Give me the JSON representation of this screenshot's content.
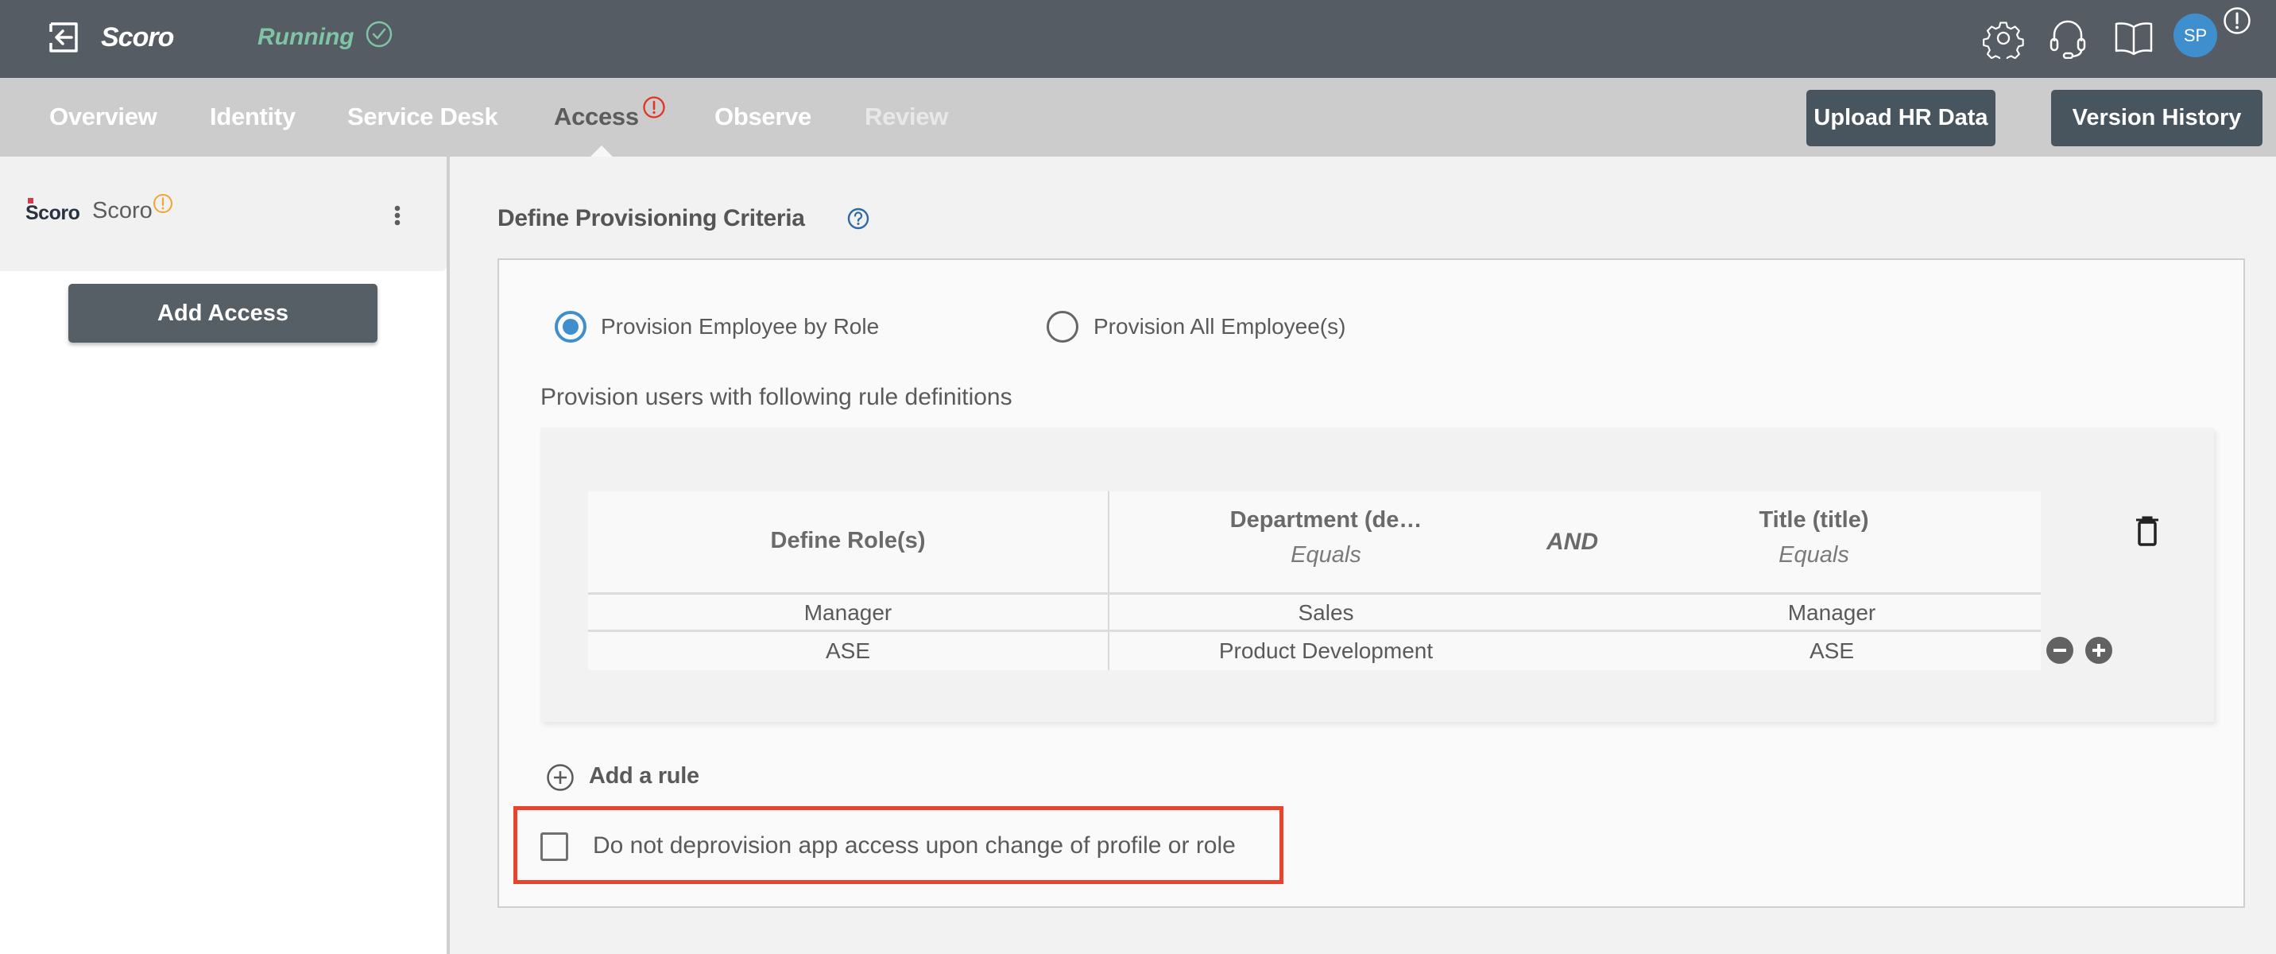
{
  "topbar": {
    "app_name": "Scoro",
    "status": "Running",
    "status_color": "#7fc4a4",
    "icons": [
      "back-icon",
      "settings-gear-icon",
      "headset-support-icon",
      "book-docs-icon",
      "alert-icon"
    ],
    "avatar_initials": "SP",
    "avatar_color": "#3f8fce"
  },
  "tabs": [
    {
      "label": "Overview",
      "state": "normal"
    },
    {
      "label": "Identity",
      "state": "normal"
    },
    {
      "label": "Service Desk",
      "state": "normal"
    },
    {
      "label": "Access",
      "state": "active",
      "alert": true
    },
    {
      "label": "Observe",
      "state": "normal"
    },
    {
      "label": "Review",
      "state": "disabled"
    }
  ],
  "header_buttons": {
    "upload_hr": "Upload HR Data",
    "version_history": "Version History"
  },
  "sidebar": {
    "logo_text": "Scoro",
    "app_name": "Scoro",
    "app_warning": true,
    "add_access_label": "Add Access"
  },
  "main": {
    "title": "Define Provisioning Criteria",
    "radio_options": [
      {
        "label": "Provision Employee by Role",
        "checked": true
      },
      {
        "label": "Provision All Employee(s)",
        "checked": false
      }
    ],
    "subheading": "Provision users with following rule definitions",
    "rule_table": {
      "role_header": "Define Role(s)",
      "conditions": [
        {
          "header": "Department (de…",
          "operator": "Equals"
        },
        {
          "header": "Title (title)",
          "operator": "Equals"
        }
      ],
      "conjunction": "AND",
      "rows": [
        {
          "role": "Manager",
          "department": "Sales",
          "title": "Manager"
        },
        {
          "role": "ASE",
          "department": "Product Development",
          "title": "ASE"
        }
      ]
    },
    "add_rule_label": "Add a rule",
    "deprovision_checkbox": {
      "label": "Do not deprovision app access upon change of profile or role",
      "checked": false,
      "highlight_color": "#e8432c"
    }
  }
}
